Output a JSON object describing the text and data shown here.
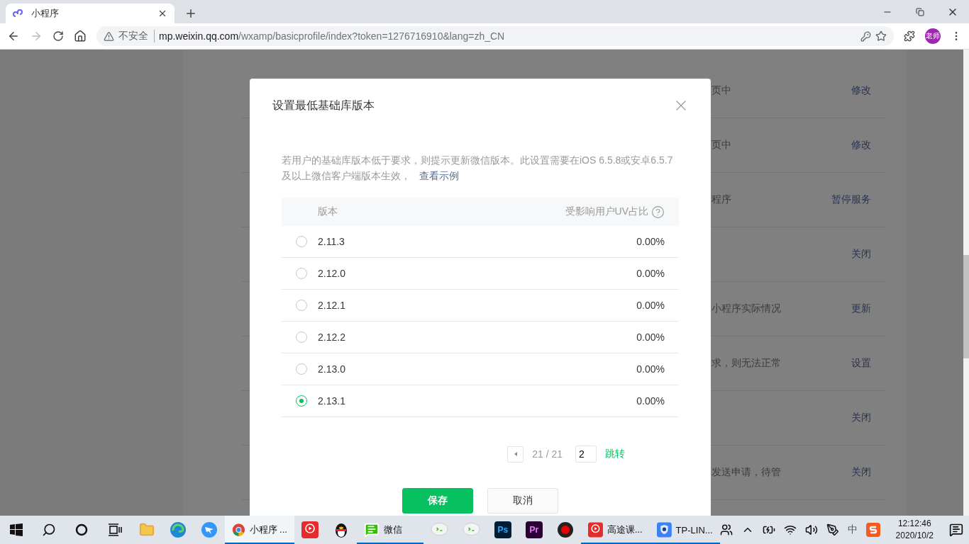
{
  "browser": {
    "tab_title": "小程序",
    "url_warning": "不安全",
    "url_host": "mp.weixin.qq.com",
    "url_path": "/wxamp/basicprofile/index?token=1276716910&lang=zh_CN",
    "avatar": "老师"
  },
  "background_rows": [
    {
      "text": "页中",
      "action": "修改"
    },
    {
      "text": "页中",
      "action": "修改"
    },
    {
      "text": "程序",
      "action": "暂停服务"
    },
    {
      "action": "关闭"
    },
    {
      "text": "小程序实际情况",
      "action": "更新"
    },
    {
      "text": "求，则无法正常",
      "action": "设置"
    },
    {
      "action": "关闭"
    },
    {
      "text": "发送申请，待管",
      "action": "关闭"
    }
  ],
  "dialog": {
    "title": "设置最低基础库版本",
    "description": "若用户的基础库版本低于要求，则提示更新微信版本。此设置需要在iOS 6.5.8或安卓6.5.7及以上微信客户端版本生效，",
    "link": "查看示例",
    "columns": [
      "版本",
      "受影响用户UV占比"
    ],
    "rows": [
      {
        "version": "2.11.3",
        "share": "0.00%",
        "selected": false
      },
      {
        "version": "2.12.0",
        "share": "0.00%",
        "selected": false
      },
      {
        "version": "2.12.1",
        "share": "0.00%",
        "selected": false
      },
      {
        "version": "2.12.2",
        "share": "0.00%",
        "selected": false
      },
      {
        "version": "2.13.0",
        "share": "0.00%",
        "selected": false
      },
      {
        "version": "2.13.1",
        "share": "0.00%",
        "selected": true
      }
    ],
    "pagination": {
      "page": "21 / 21",
      "jump_value": "2",
      "jump": "跳转"
    },
    "buttons": [
      {
        "label": "保存",
        "kind": "primary"
      },
      {
        "label": "取消",
        "kind": "default"
      }
    ]
  },
  "taskbar": {
    "apps": [
      {
        "kind": "folder",
        "running": false,
        "selected": false
      },
      {
        "kind": "edge",
        "running": false,
        "selected": false
      },
      {
        "kind": "bird",
        "running": false,
        "selected": false
      },
      {
        "kind": "chrome",
        "label": "小程序 ...",
        "running": true,
        "selected": true
      },
      {
        "kind": "play",
        "running": false,
        "selected": false
      },
      {
        "kind": "penguin",
        "running": false,
        "selected": false
      },
      {
        "kind": "wechat",
        "label": "微信",
        "running": true,
        "selected": false
      },
      {
        "kind": "bubble",
        "running": false,
        "selected": false
      },
      {
        "kind": "bubble",
        "running": false,
        "selected": false
      },
      {
        "kind": "ps",
        "text": "Ps",
        "running": false,
        "selected": false
      },
      {
        "kind": "pr",
        "text": "Pr",
        "running": false,
        "selected": false
      },
      {
        "kind": "record",
        "running": false,
        "selected": false
      },
      {
        "kind": "play",
        "label": "高途课...",
        "running": true,
        "selected": false
      },
      {
        "kind": "shield",
        "label": "TP-LIN...",
        "running": true,
        "selected": false
      }
    ],
    "ime": "中",
    "time": "12:12:46",
    "date": "2020/10/2"
  }
}
